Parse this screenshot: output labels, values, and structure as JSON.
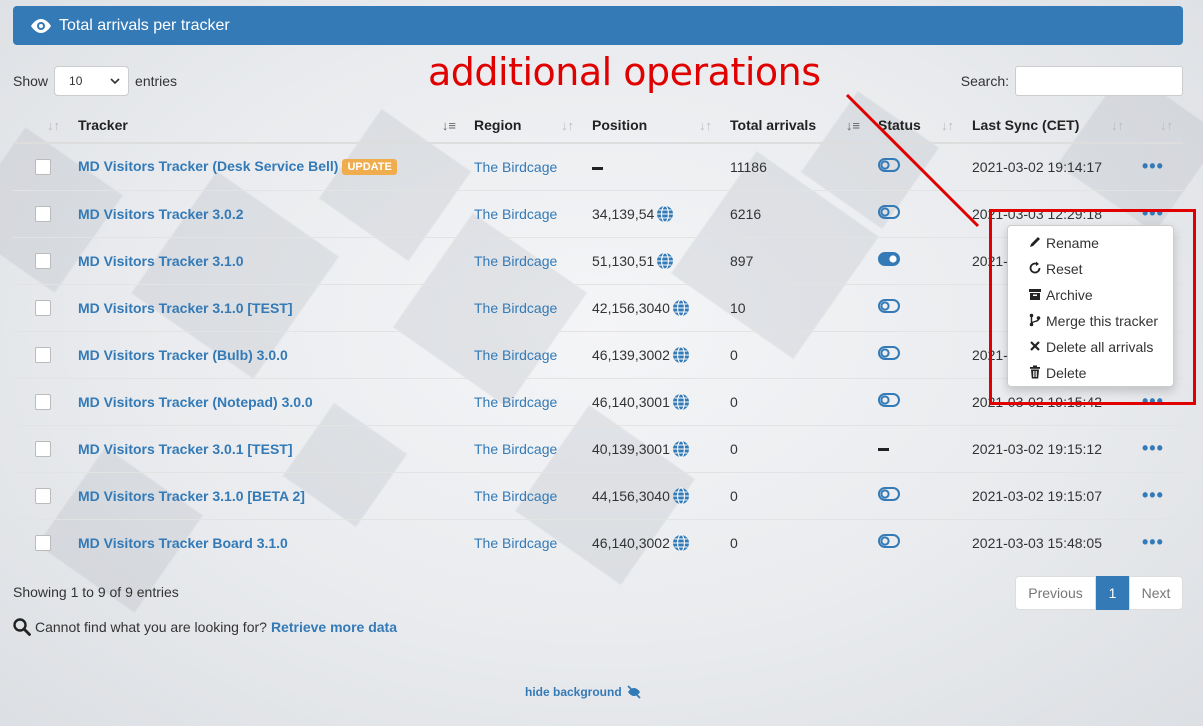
{
  "panel": {
    "title": "Total arrivals per tracker"
  },
  "length": {
    "show_label": "Show",
    "value": "10",
    "entries_label": "entries"
  },
  "search": {
    "label": "Search:",
    "value": ""
  },
  "annotation": "additional operations",
  "columns": [
    "Tracker",
    "Region",
    "Position",
    "Total arrivals",
    "Status",
    "Last Sync (CET)"
  ],
  "rows": [
    {
      "tracker": "MD Visitors Tracker (Desk Service Bell)",
      "badge": "UPDATE",
      "region": "The Birdcage",
      "position": "",
      "arrivals": "11186",
      "status": "off",
      "sync": "2021-03-02 19:14:17"
    },
    {
      "tracker": "MD Visitors Tracker 3.0.2",
      "badge": "",
      "region": "The Birdcage",
      "position": "34,139,54",
      "arrivals": "6216",
      "status": "off",
      "sync": "2021-03-03 12:29:18"
    },
    {
      "tracker": "MD Visitors Tracker 3.1.0",
      "badge": "",
      "region": "The Birdcage",
      "position": "51,130,51",
      "arrivals": "897",
      "status": "on",
      "sync": "2021-"
    },
    {
      "tracker": "MD Visitors Tracker 3.1.0 [TEST]",
      "badge": "",
      "region": "The Birdcage",
      "position": "42,156,3040",
      "arrivals": "10",
      "status": "off",
      "sync": ""
    },
    {
      "tracker": "MD Visitors Tracker (Bulb) 3.0.0",
      "badge": "",
      "region": "The Birdcage",
      "position": "46,139,3002",
      "arrivals": "0",
      "status": "off",
      "sync": "2021-"
    },
    {
      "tracker": "MD Visitors Tracker (Notepad) 3.0.0",
      "badge": "",
      "region": "The Birdcage",
      "position": "46,140,3001",
      "arrivals": "0",
      "status": "off",
      "sync": "2021-03-02 19:15:42"
    },
    {
      "tracker": "MD Visitors Tracker 3.0.1 [TEST]",
      "badge": "",
      "region": "The Birdcage",
      "position": "40,139,3001",
      "arrivals": "0",
      "status": "none",
      "sync": "2021-03-02 19:15:12"
    },
    {
      "tracker": "MD Visitors Tracker 3.1.0 [BETA 2]",
      "badge": "",
      "region": "The Birdcage",
      "position": "44,156,3040",
      "arrivals": "0",
      "status": "off",
      "sync": "2021-03-02 19:15:07"
    },
    {
      "tracker": "MD Visitors Tracker Board 3.1.0",
      "badge": "",
      "region": "The Birdcage",
      "position": "46,140,3002",
      "arrivals": "0",
      "status": "off",
      "sync": "2021-03-03 15:48:05"
    }
  ],
  "menu": [
    {
      "label": "Rename",
      "icon": "pencil-icon"
    },
    {
      "label": "Reset",
      "icon": "reset-icon"
    },
    {
      "label": "Archive",
      "icon": "archive-icon"
    },
    {
      "label": "Merge this tracker",
      "icon": "merge-icon"
    },
    {
      "label": "Delete all arrivals",
      "icon": "x-icon"
    },
    {
      "label": "Delete",
      "icon": "trash-icon"
    }
  ],
  "footer": {
    "showing": "Showing 1 to 9 of 9 entries",
    "prev": "Previous",
    "page": "1",
    "next": "Next",
    "cannot_find": "Cannot find what you are looking for?",
    "retrieve": "Retrieve more data",
    "hide_bg": "hide background"
  },
  "colors": {
    "primary": "#337ab7",
    "badge": "#f0ad4e",
    "annotation": "#e00000"
  }
}
